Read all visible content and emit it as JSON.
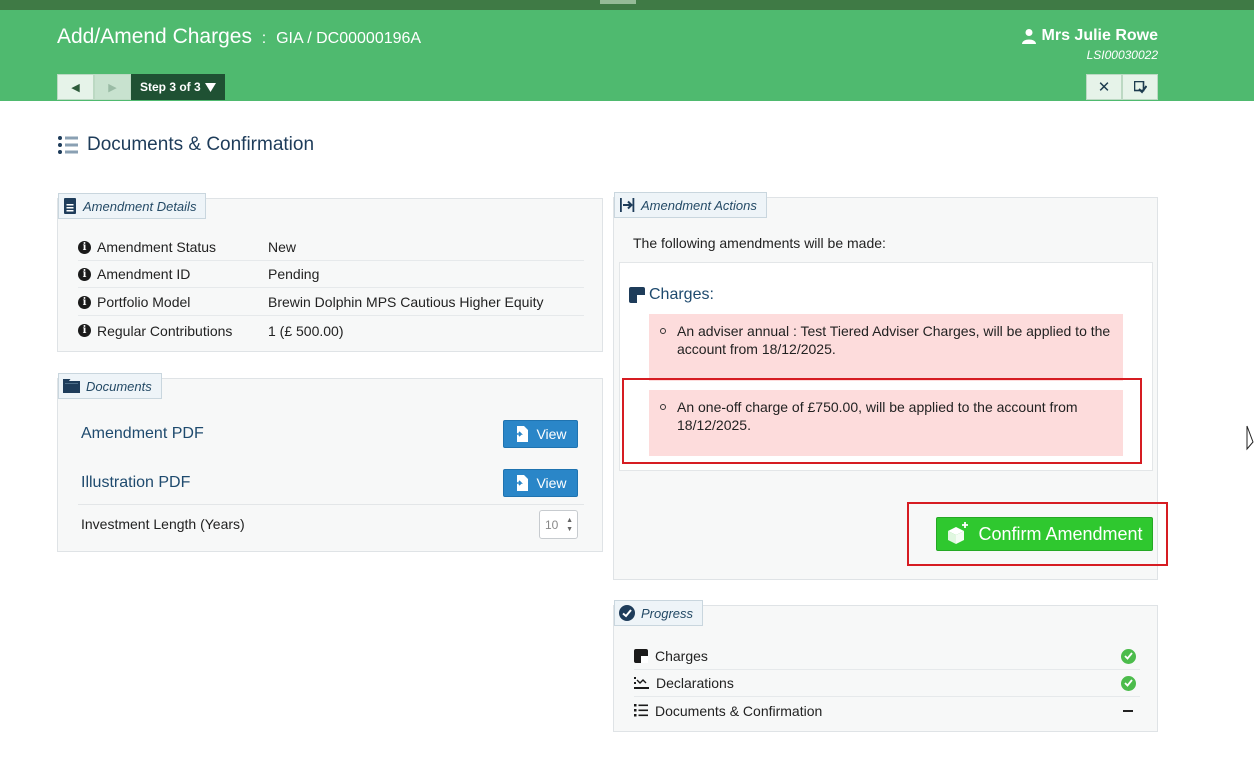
{
  "header": {
    "title": "Add/Amend Charges",
    "separator": ":",
    "subtitle": "GIA / DC00000196A",
    "user_name": "Mrs Julie Rowe",
    "user_ref": "LSI00030022",
    "step_label": "Step 3 of 3",
    "colors": {
      "header": "#4fba6f",
      "step_button": "#1f5133"
    },
    "icons": [
      "prev-arrow-icon",
      "next-arrow-icon",
      "caret-down-icon",
      "close-icon",
      "save-check-icon",
      "user-icon"
    ]
  },
  "section": {
    "title": "Documents & Confirmation",
    "icon": "list-icon"
  },
  "amendment_details": {
    "legend": "Amendment Details",
    "rows": [
      {
        "label": "Amendment Status",
        "value": "New"
      },
      {
        "label": "Amendment ID",
        "value": "Pending"
      },
      {
        "label": "Portfolio Model",
        "value": "Brewin Dolphin MPS Cautious Higher Equity"
      },
      {
        "label": "Regular Contributions",
        "value": "1 (£ 500.00)"
      }
    ]
  },
  "documents": {
    "legend": "Documents",
    "items": [
      {
        "label": "Amendment PDF",
        "button": "View"
      },
      {
        "label": "Illustration PDF",
        "button": "View"
      }
    ],
    "investment_length_label": "Investment Length (Years)",
    "investment_length_value": "10"
  },
  "amendment_actions": {
    "legend": "Amendment Actions",
    "intro": "The following amendments will be made:",
    "charges_heading": "Charges:",
    "items": [
      "An adviser annual : Test Tiered Adviser Charges, will be applied to the account from 18/12/2025.",
      "An one-off charge of £750.00, will be applied to the account from 18/12/2025."
    ],
    "confirm_label": "Confirm Amendment",
    "colors": {
      "alert": "#fddcdc",
      "confirm": "#2fc82f",
      "highlight": "#d61c22"
    }
  },
  "progress": {
    "legend": "Progress",
    "steps": [
      {
        "label": "Charges",
        "status": "complete"
      },
      {
        "label": "Declarations",
        "status": "complete"
      },
      {
        "label": "Documents & Confirmation",
        "status": "in-progress"
      }
    ]
  }
}
